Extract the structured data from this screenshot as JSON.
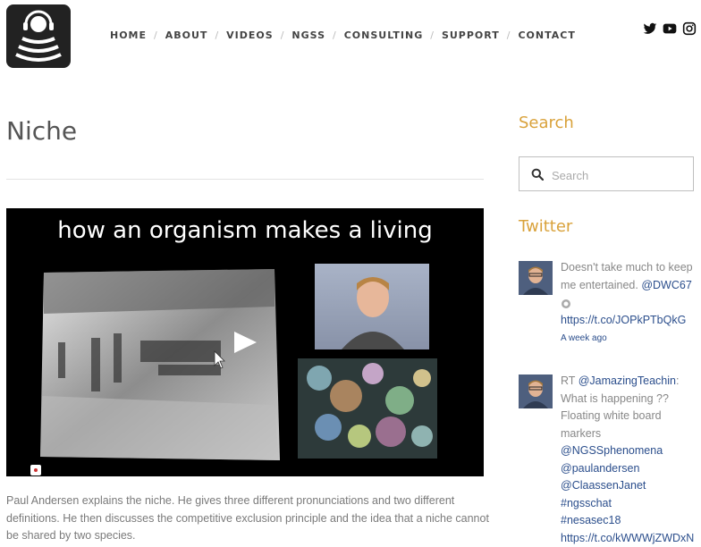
{
  "nav": {
    "items": [
      "HOME",
      "ABOUT",
      "VIDEOS",
      "NGSS",
      "CONSULTING",
      "SUPPORT",
      "CONTACT"
    ]
  },
  "social": [
    "twitter-icon",
    "youtube-icon",
    "instagram-icon"
  ],
  "page": {
    "title": "Niche",
    "video_title": "how an organism makes a living",
    "excerpt": "Paul Andersen explains the niche. He gives three different pronunciations and two different definitions. He then discusses the competitive exclusion principle and the idea that a niche cannot be shared by two species."
  },
  "sidebar": {
    "search_heading": "Search",
    "search_placeholder": "Search",
    "twitter_heading": "Twitter",
    "tweets": [
      {
        "lines": [
          "Doesn't take much to keep",
          "me entertained. ",
          "@DWC67",
          "https://t.co/JOPkPTbQkG"
        ],
        "time": "A week ago"
      },
      {
        "lines": [
          "RT ",
          "@JamazingTeachin",
          ":",
          "What is happening ??",
          "Floating white board",
          "markers",
          "@NGSSphenomena",
          "@paulandersen",
          "@ClaassenJanet #ngsschat",
          "#nesasec18",
          "https://t.co/kWWWjZWDxN"
        ]
      }
    ]
  },
  "colors": {
    "accent": "#d9a23b",
    "link": "#2b4e8c",
    "text": "#555555"
  }
}
